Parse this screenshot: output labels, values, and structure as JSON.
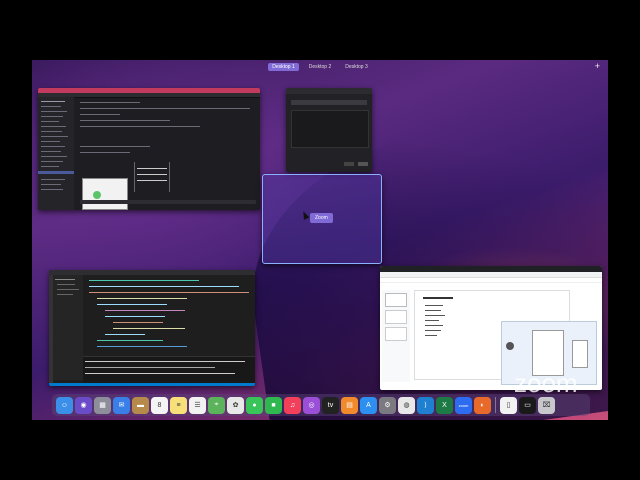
{
  "desktops": {
    "items": [
      {
        "label": "Desktop 1",
        "active": true
      },
      {
        "label": "Desktop 2",
        "active": false
      },
      {
        "label": "Desktop 3",
        "active": false
      }
    ],
    "add_label": "+"
  },
  "zoom_window": {
    "label": "Zoom"
  },
  "watermark": "zoom",
  "dock": {
    "apps": [
      {
        "name": "finder-icon",
        "color": "#3b8fe8",
        "glyph": "☺"
      },
      {
        "name": "siri-icon",
        "color": "#6b4cc8",
        "glyph": "◉"
      },
      {
        "name": "launchpad-icon",
        "color": "#8e8e9a",
        "glyph": "▦"
      },
      {
        "name": "mail-icon",
        "color": "#3a7ee8",
        "glyph": "✉"
      },
      {
        "name": "folder-icon",
        "color": "#b58a4a",
        "glyph": "▬"
      },
      {
        "name": "calendar-icon",
        "color": "#f4f4f4",
        "glyph": "8"
      },
      {
        "name": "notes-icon",
        "color": "#f7e07a",
        "glyph": "≡"
      },
      {
        "name": "reminders-icon",
        "color": "#f2f2f2",
        "glyph": "☰"
      },
      {
        "name": "maps-icon",
        "color": "#5bb35b",
        "glyph": "⌖"
      },
      {
        "name": "photos-icon",
        "color": "#e8e8e8",
        "glyph": "✿"
      },
      {
        "name": "messages-icon",
        "color": "#39c45a",
        "glyph": "●"
      },
      {
        "name": "facetime-icon",
        "color": "#2fb84f",
        "glyph": "■"
      },
      {
        "name": "music-icon",
        "color": "#f2405a",
        "glyph": "♫"
      },
      {
        "name": "podcasts-icon",
        "color": "#9a4fd6",
        "glyph": "◎"
      },
      {
        "name": "tv-icon",
        "color": "#222222",
        "glyph": "tv"
      },
      {
        "name": "books-icon",
        "color": "#f08a2a",
        "glyph": "▤"
      },
      {
        "name": "app-store-icon",
        "color": "#2d8ff0",
        "glyph": "A"
      },
      {
        "name": "system-preferences-icon",
        "color": "#7a7a80",
        "glyph": "⚙"
      },
      {
        "name": "chrome-icon",
        "color": "#e8e8e8",
        "glyph": "◍"
      },
      {
        "name": "vscode-icon",
        "color": "#1f7fd1",
        "glyph": "⟩"
      },
      {
        "name": "excel-icon",
        "color": "#1d7a45",
        "glyph": "X"
      },
      {
        "name": "zoom-app-icon",
        "color": "#2d6cf0",
        "glyph": "zoom"
      },
      {
        "name": "firefox-icon",
        "color": "#e86a2a",
        "glyph": "◐"
      }
    ],
    "right_items": [
      {
        "name": "document-icon",
        "color": "#f2f2f2",
        "glyph": "▯"
      },
      {
        "name": "window-preview-icon",
        "color": "#1a1a1a",
        "glyph": "▭"
      },
      {
        "name": "trash-icon",
        "color": "#c8c8cc",
        "glyph": "⌧"
      }
    ]
  }
}
